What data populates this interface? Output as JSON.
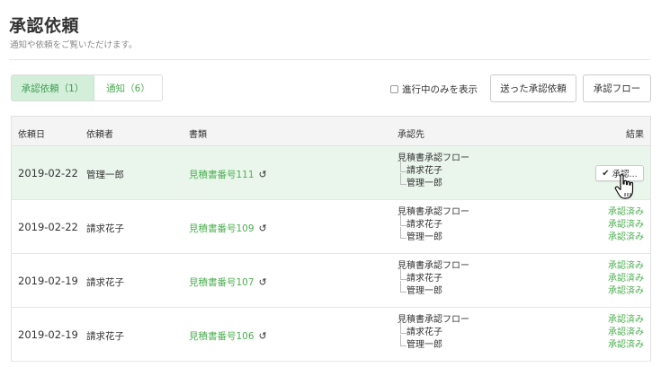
{
  "page": {
    "title": "承認依頼",
    "subtitle": "通知や依頼をご覧いただけます。"
  },
  "tabs": [
    {
      "label": "承認依頼（1）",
      "active": true
    },
    {
      "label": "通知（6）",
      "active": false
    }
  ],
  "toolbar": {
    "filter_label": "進行中のみを表示",
    "sent_button": "送った承認依頼",
    "flow_button": "承認フロー"
  },
  "table": {
    "headers": {
      "date": "依頼日",
      "requester": "依頼者",
      "document": "書類",
      "approvers": "承認先",
      "result": "結果"
    },
    "rows": [
      {
        "date": "2019-02-22",
        "requester": "管理一郎",
        "document": "見積書番号111",
        "flow": "見積書承認フロー",
        "approvers": [
          "請求花子",
          "管理一郎"
        ],
        "action_label": "承認...",
        "results": []
      },
      {
        "date": "2019-02-22",
        "requester": "請求花子",
        "document": "見積書番号109",
        "flow": "見積書承認フロー",
        "approvers": [
          "請求花子",
          "管理一郎"
        ],
        "results": [
          "承認済み",
          "承認済み",
          "承認済み"
        ]
      },
      {
        "date": "2019-02-19",
        "requester": "請求花子",
        "document": "見積書番号107",
        "flow": "見積書承認フロー",
        "approvers": [
          "請求花子",
          "管理一郎"
        ],
        "results": [
          "承認済み",
          "承認済み",
          "承認済み"
        ]
      },
      {
        "date": "2019-02-19",
        "requester": "請求花子",
        "document": "見積書番号106",
        "flow": "見積書承認フロー",
        "approvers": [
          "請求花子",
          "管理一郎"
        ],
        "results": [
          "承認済み",
          "承認済み",
          "承認済み"
        ]
      }
    ]
  },
  "icons": {
    "history": "history-icon",
    "check": "check-icon",
    "cursor": "hand-pointer-icon"
  },
  "colors": {
    "accent_green": "#4caf50",
    "active_tab_bg": "#d3efd9",
    "highlight_row_bg": "#eaf6ec",
    "header_bg": "#f4f4f4"
  }
}
